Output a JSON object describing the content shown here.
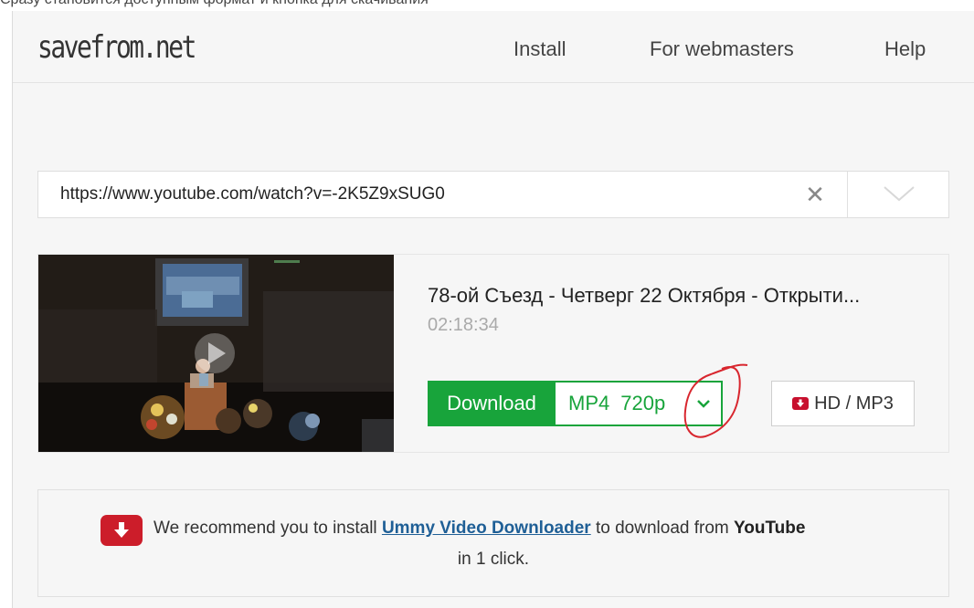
{
  "site": {
    "logo": "savefrom.net",
    "top_cut_text": "Сразу становится доступным формат и кнопка для скачивания"
  },
  "nav": {
    "install": "Install",
    "webmasters": "For webmasters",
    "help": "Help"
  },
  "search": {
    "url": "https://www.youtube.com/watch?v=-2K5Z9xSUG0"
  },
  "video": {
    "title": "78-ой Съезд - Четверг 22 Октября - Открыти...",
    "duration": "02:18:34"
  },
  "download": {
    "button_label": "Download",
    "format": "MP4",
    "quality": "720p",
    "hd_label": "HD / MP3"
  },
  "recommend": {
    "prefix": "We recommend you to install ",
    "link": "Ummy Video Downloader",
    "middle": " to download from ",
    "brand": "YouTube",
    "line2": "in 1 click."
  },
  "colors": {
    "download_green": "#18a43b",
    "hd_red": "#c8102e",
    "annotation_red": "#d8262e",
    "link_blue": "#1f5f96"
  },
  "icons": [
    "clear-icon",
    "chevron-down-icon",
    "play-icon",
    "download-arrow-icon"
  ]
}
